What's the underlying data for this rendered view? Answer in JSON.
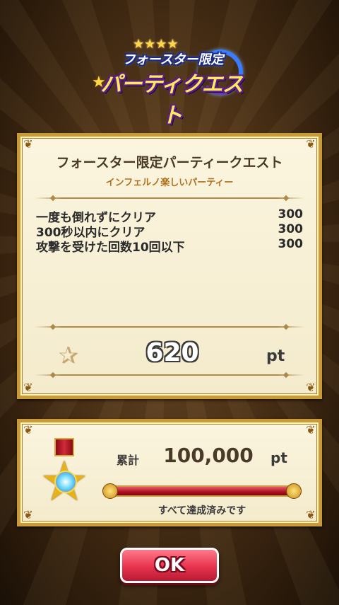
{
  "logo": {
    "line1": "フォースター限定",
    "line2": "パーティクエスト",
    "stars": "★★★★"
  },
  "quest": {
    "title": "フォースター限定パーティークエスト",
    "subtitle": "インフェルノ楽しいパーティー",
    "conditions": [
      {
        "label": "一度も倒れずにクリア",
        "points": "300"
      },
      {
        "label": "300秒以内にクリア",
        "points": "300"
      },
      {
        "label": "攻撃を受けた回数10回以下",
        "points": "300"
      }
    ],
    "earned_points": "620",
    "points_unit": "pt"
  },
  "total": {
    "label": "累計",
    "value": "100,000",
    "unit": "pt",
    "progress_fraction": 1.0,
    "status_text": "すべて達成済みです"
  },
  "ok_button": {
    "label": "OK"
  },
  "colors": {
    "panel_border": "#c89a3a",
    "panel_bg": "#fbf5df",
    "progress_fill": "#b0101e",
    "ok_button": "#e8334e",
    "subtitle": "#b0701e"
  },
  "icons": {
    "points": "star-swoosh-icon",
    "medal": "star-medal-icon"
  }
}
